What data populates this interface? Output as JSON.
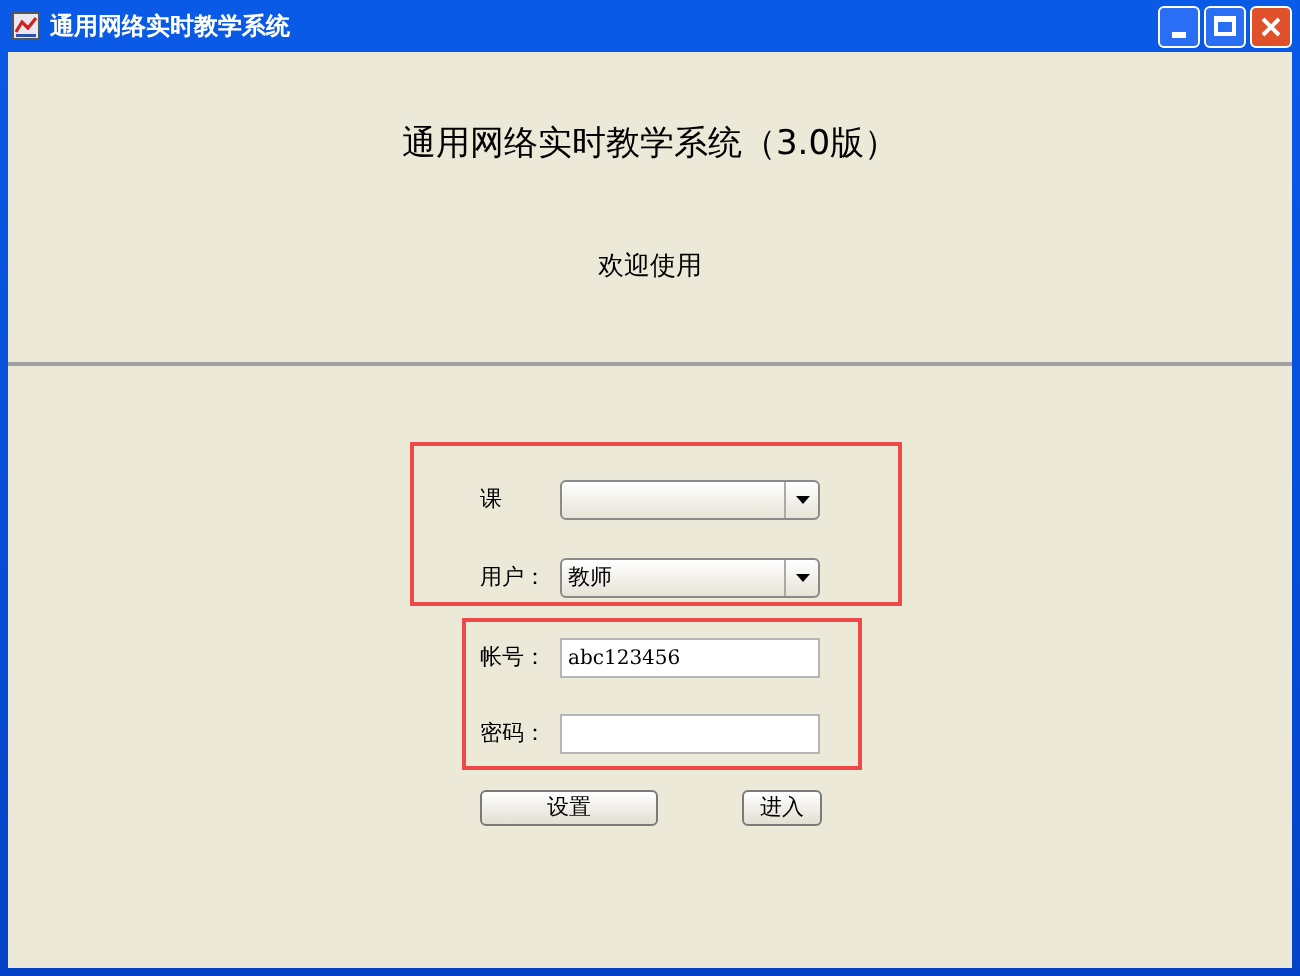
{
  "window": {
    "title": "通用网络实时教学系统"
  },
  "header": {
    "title": "通用网络实时教学系统（3.0版）",
    "subtitle": "欢迎使用"
  },
  "selects": [
    {
      "label": "课"
    },
    {
      "label": "用户：",
      "value": "教师"
    }
  ],
  "fields": [
    {
      "label": "帐号：",
      "value": "abc123456"
    },
    {
      "label": "密码："
    }
  ],
  "buttons": [
    "设置",
    "进入"
  ]
}
